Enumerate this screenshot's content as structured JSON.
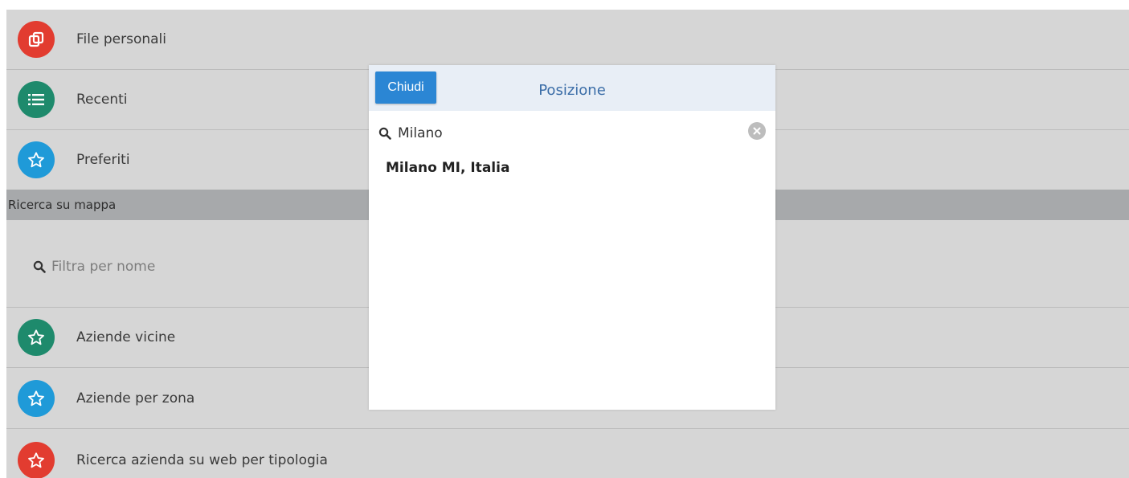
{
  "menu": {
    "items": [
      {
        "label": "File personali",
        "icon": "files-icon",
        "color": "#e23c30"
      },
      {
        "label": "Recenti",
        "icon": "list-icon",
        "color": "#1e8a6c"
      },
      {
        "label": "Preferiti",
        "icon": "star-icon",
        "color": "#1f9ad8"
      }
    ]
  },
  "map_section": {
    "header": "Ricerca su mappa",
    "filter_placeholder": "Filtra per nome",
    "items": [
      {
        "label": "Aziende vicine",
        "icon": "star-icon",
        "color": "#1e8a6c"
      },
      {
        "label": "Aziende per zona",
        "icon": "star-icon",
        "color": "#1f9ad8"
      },
      {
        "label": "Ricerca azienda su web per tipologia",
        "icon": "star-icon",
        "color": "#e23c30"
      }
    ]
  },
  "modal": {
    "close_label": "Chiudi",
    "title": "Posizione",
    "search_value": "Milano",
    "results": [
      "Milano MI, Italia"
    ]
  }
}
